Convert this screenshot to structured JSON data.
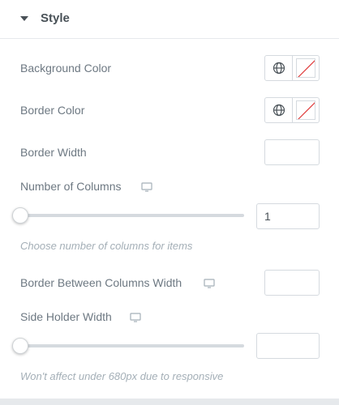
{
  "section": {
    "title": "Style",
    "expanded": true
  },
  "controls": {
    "background_color": {
      "label": "Background Color"
    },
    "border_color": {
      "label": "Border Color"
    },
    "border_width": {
      "label": "Border Width",
      "value": ""
    },
    "number_of_columns": {
      "label": "Number of Columns",
      "value": "1",
      "help": "Choose number of columns for items"
    },
    "border_between_columns_width": {
      "label": "Border Between Columns Width",
      "value": ""
    },
    "side_holder_width": {
      "label": "Side Holder Width",
      "value": "",
      "help": "Won't affect under 680px due to responsive"
    }
  },
  "icons": {
    "section_toggle": "caret-down-icon",
    "global_color": "globe-icon",
    "no_color": "clear-swatch-icon",
    "responsive": "desktop-icon"
  },
  "colors": {
    "label": "#6d7882",
    "header_text": "#495157",
    "border": "#d5dadf",
    "help_text": "#a4afb7",
    "no_color_slash": "#e03b3b"
  }
}
